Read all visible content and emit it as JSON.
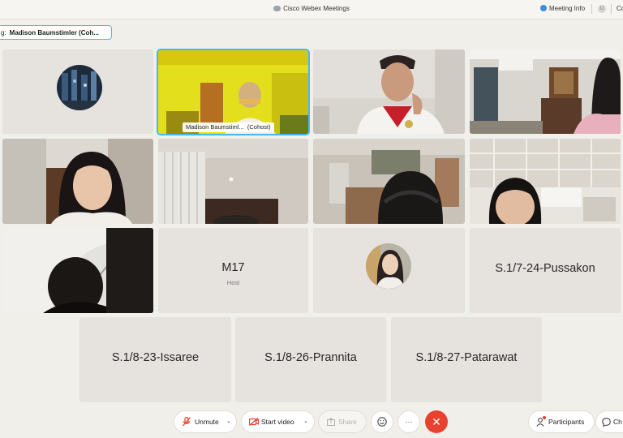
{
  "window": {
    "title": "Cisco Webex Meetings",
    "meeting_info_label": "Meeting Info",
    "avatar_initial": "U",
    "right_cut_text": "Co"
  },
  "speaking": {
    "prefix": "g:",
    "name": "Madison Baumstimler (Coh..."
  },
  "tiles": {
    "t2_label": "Madison Baumstiml...",
    "t2_role": "(Cohost)",
    "m17_name": "M17",
    "m17_role": "Host",
    "pussakon": "S.1/7-24-Pussakon",
    "issaree": "S.1/8-23-Issaree",
    "prannita": "S.1/8-26-Prannita",
    "patarawat": "S.1/8-27-Patarawat"
  },
  "controls": {
    "unmute": "Unmute",
    "start_video": "Start video",
    "share": "Share",
    "more": "···",
    "participants": "Participants",
    "chat": "Ch"
  },
  "colors": {
    "accent": "#43b9ef",
    "end_call": "#e8412f",
    "mute_red": "#e8412f"
  }
}
